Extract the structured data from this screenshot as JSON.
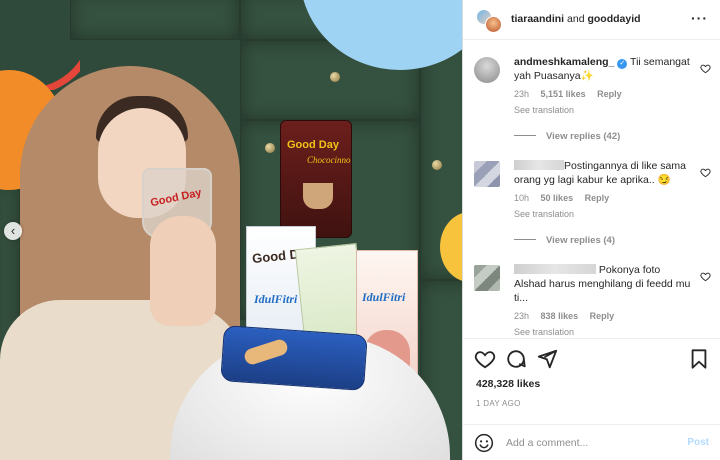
{
  "post": {
    "header": {
      "author_primary": "tiaraandini",
      "joiner": " and ",
      "author_secondary": "gooddayid"
    },
    "photo": {
      "glass_brand": "Good Day",
      "pack_brand": "Good Day",
      "pack_variant": "Chococinno",
      "box_brand": "Good Day",
      "box_text": "IdulFitri",
      "box3_text": "IdulFitri"
    },
    "comments": [
      {
        "username": "andmeshkamaleng_",
        "verified": true,
        "text": " Tii semangat yah Puasanya✨",
        "time": "23h",
        "likes": "5,151 likes",
        "reply": "Reply",
        "see_translation": "See translation",
        "view_replies": "View replies (42)"
      },
      {
        "username": "",
        "text": "Postingannya di like sama orang yg lagi kabur ke aprika.. 😏",
        "time": "10h",
        "likes": "50 likes",
        "reply": "Reply",
        "see_translation": "See translation",
        "view_replies": "View replies (4)"
      },
      {
        "username": "",
        "text": " Pokonya foto Alshad harus menghilang di feedd mu ti...",
        "time": "23h",
        "likes": "838 likes",
        "reply": "Reply",
        "see_translation": "See translation"
      }
    ],
    "like_count": "428,328 likes",
    "posted_ago": "1 DAY AGO",
    "add_comment": {
      "placeholder": "Add a comment...",
      "post_label": "Post"
    }
  },
  "colors": {
    "link_blue": "#3897f0",
    "post_button_disabled": "#b3dbff",
    "secondary_text": "#8e8e8e",
    "primary_text": "#262626",
    "deco_red": "#e4473a",
    "deco_orange": "#f28c28",
    "deco_sky": "#9fd3f3",
    "deco_yellow": "#f7c23c"
  },
  "icons": [
    "more-icon",
    "heart-icon",
    "comment-icon",
    "share-icon",
    "bookmark-icon",
    "emoji-icon",
    "chevron-left-icon",
    "verified-icon"
  ]
}
